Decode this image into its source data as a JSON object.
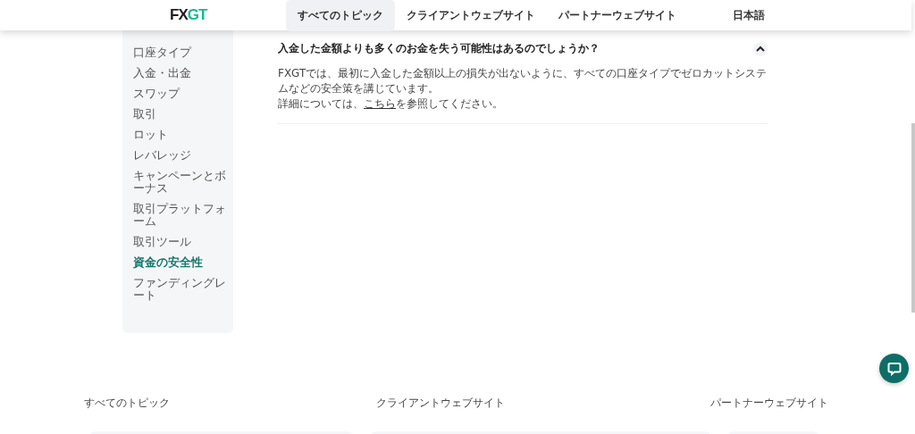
{
  "header": {
    "logo": {
      "part_1": "FX",
      "part_2": "GT"
    },
    "nav": [
      {
        "label": "すべてのトピック",
        "selected": true
      },
      {
        "label": "クライアントウェブサイト",
        "selected": false
      },
      {
        "label": "パートナーウェブサイト",
        "selected": false
      }
    ],
    "language": "日本語"
  },
  "sidebar": {
    "items": [
      {
        "label": "口座タイプ",
        "selected": false
      },
      {
        "label": "入金・出金",
        "selected": false
      },
      {
        "label": "スワップ",
        "selected": false
      },
      {
        "label": "取引",
        "selected": false
      },
      {
        "label": "ロット",
        "selected": false
      },
      {
        "label": "レバレッジ",
        "selected": false
      },
      {
        "label": "キャンペーンとボーナス",
        "selected": false
      },
      {
        "label": "取引プラットフォーム",
        "selected": false
      },
      {
        "label": "取引ツール",
        "selected": false
      },
      {
        "label": "資金の安全性",
        "selected": true
      },
      {
        "label": "ファンディングレート",
        "selected": false
      }
    ]
  },
  "faq": [
    {
      "question": "入金した金額よりも多くのお金を失う可能性はあるのでしょうか？",
      "expanded": true,
      "answer": [
        "FXGTでは、最初に入金した金額以上の損失が出ないように、すべての口座タイプでゼロカットシステムなどの安全策を講じています。"
      ],
      "detail": {
        "before": "詳細については、",
        "link": "こちら",
        "after": "を参照してください。"
      }
    }
  ],
  "footer": {
    "links": [
      "すべてのトピック",
      "クライアントウェブサイト",
      "パートナーウェブサイト"
    ]
  }
}
